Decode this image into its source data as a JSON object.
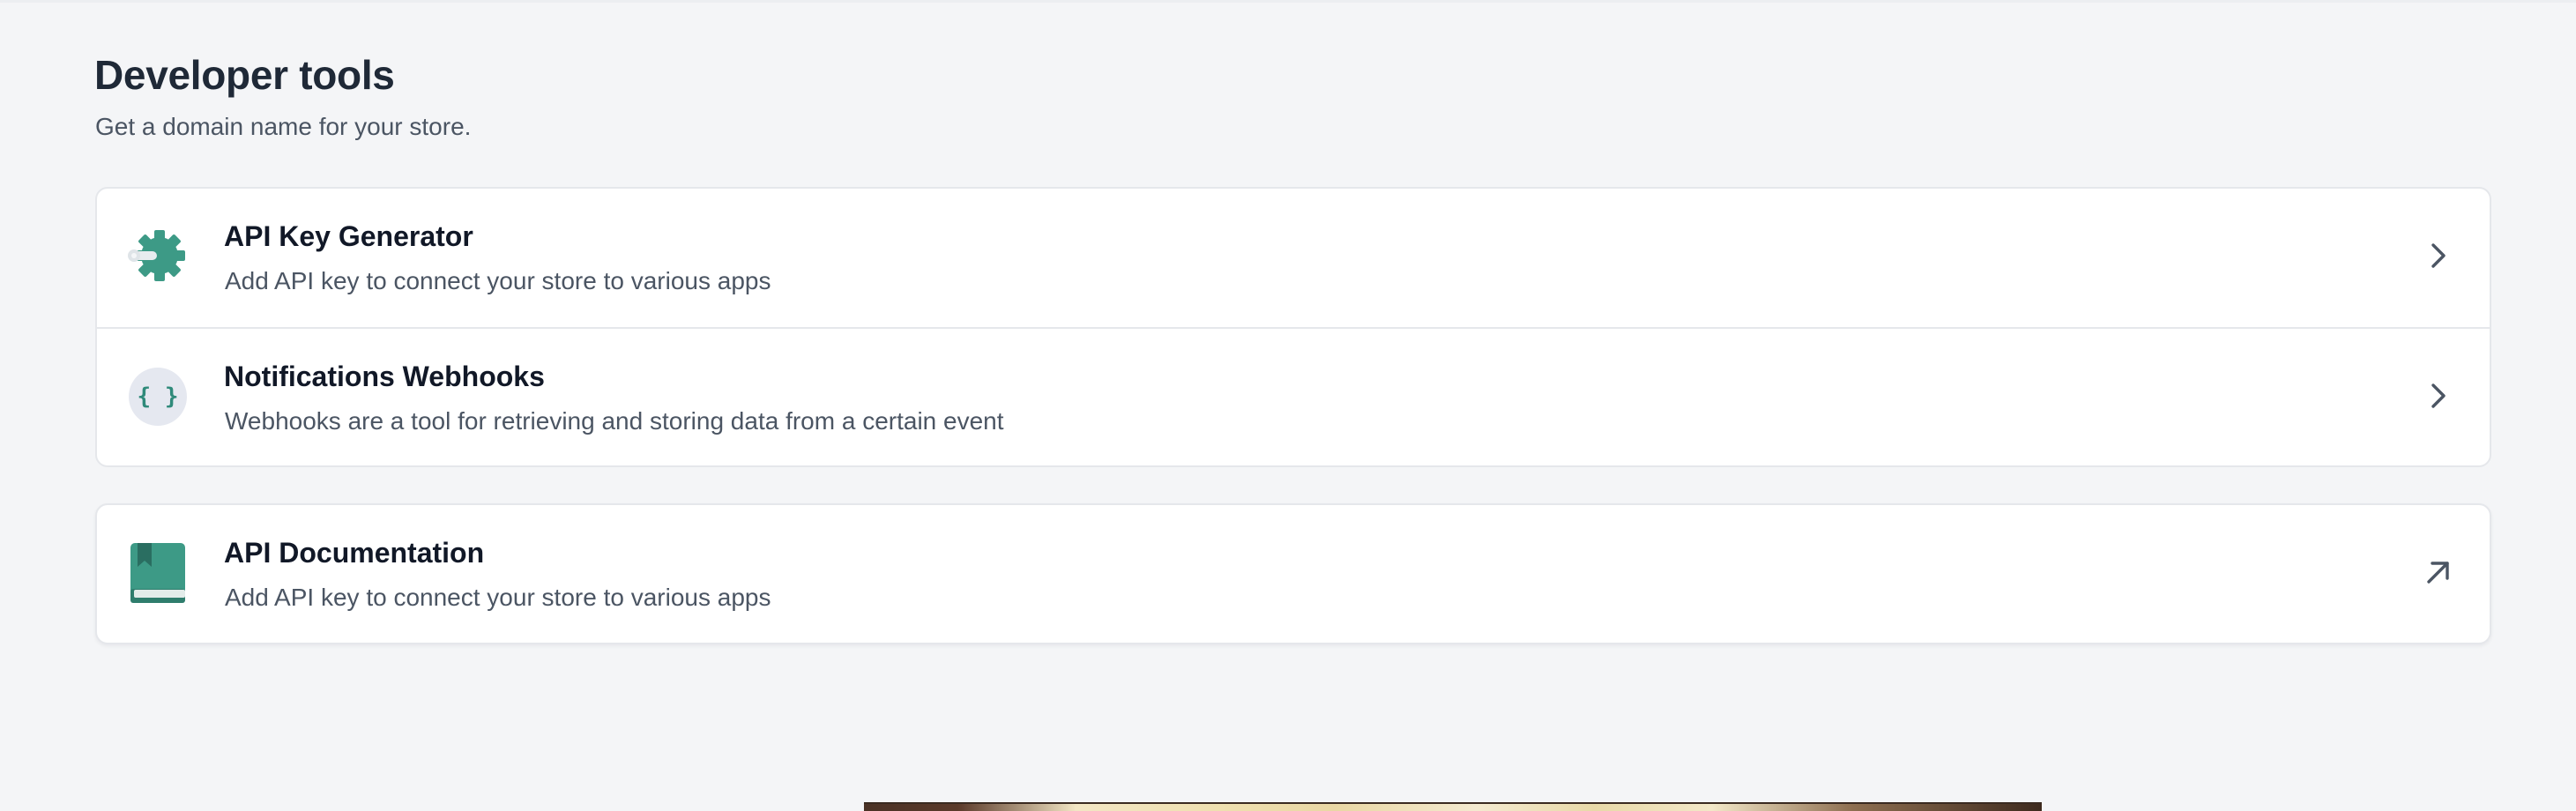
{
  "page": {
    "title": "Developer tools",
    "subtitle": "Get a domain name for your store."
  },
  "tools": [
    {
      "title": "API Key Generator",
      "description": "Add API key to connect your store to various apps",
      "icon": "gear-key-icon",
      "action_icon": "chevron-right-icon"
    },
    {
      "title": "Notifications Webhooks",
      "description": "Webhooks are a tool for retrieving and storing data from a certain event",
      "icon": "curly-braces-icon",
      "icon_text": "{ }",
      "action_icon": "chevron-right-icon"
    }
  ],
  "docs": {
    "title": "API Documentation",
    "description": "Add API key to connect your store to various apps",
    "icon": "book-icon",
    "action_icon": "external-arrow-icon"
  },
  "colors": {
    "accent": "#3d9a86",
    "background": "#f4f5f7",
    "card": "#ffffff",
    "border": "#e5e7eb",
    "title": "#111827",
    "text": "#4b5563"
  }
}
